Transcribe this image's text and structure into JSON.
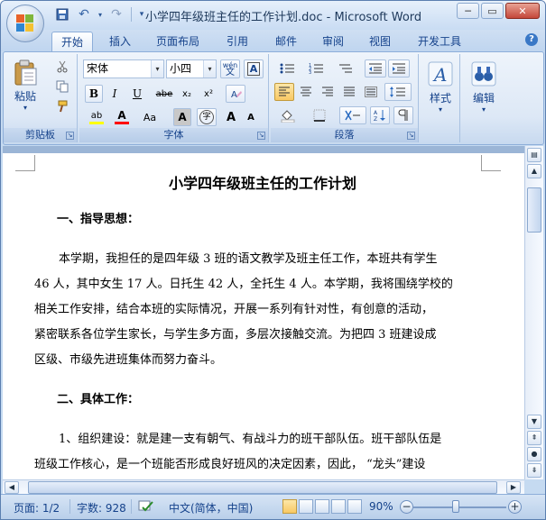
{
  "window": {
    "title": "小学四年级班主任的工作计划.doc - Microsoft Word",
    "controls": {
      "minimize": "─",
      "restore": "▭",
      "close": "✕"
    }
  },
  "qat": {
    "save": "💾",
    "undo": "↶",
    "redo": "↷",
    "customize": "▾"
  },
  "tabs": [
    "开始",
    "插入",
    "页面布局",
    "引用",
    "邮件",
    "审阅",
    "视图",
    "开发工具"
  ],
  "active_tab": "开始",
  "ribbon": {
    "clipboard": {
      "label": "剪贴板",
      "paste": "粘贴",
      "paste_dd": "▾"
    },
    "font": {
      "label": "字体",
      "font_name": "宋体",
      "font_size": "小四",
      "wen": "wén",
      "wen_sub": "文",
      "buttons": {
        "bold": "B",
        "italic": "I",
        "underline": "U",
        "strike": "abe",
        "subscript": "x₂",
        "superscript": "x²",
        "clear": "A",
        "highlight": "ab",
        "fontcolor": "A",
        "changecase": "Aa",
        "charshading": "A",
        "enclose": "字",
        "grow": "A",
        "shrink": "A"
      }
    },
    "paragraph": {
      "label": "段落"
    },
    "styles": {
      "label": "样式"
    },
    "editing": {
      "label": "编辑"
    }
  },
  "document": {
    "title": "小学四年级班主任的工作计划",
    "heading1": "一、指导思想：",
    "para1": [
      "本学期，我担任的是四年级 3 班的语文教学及班主任工作，本班共有学生",
      "46 人，其中女生 17 人。日托生 42 人，全托生 4 人。本学期，我将围绕学校的",
      "相关工作安排，结合本班的实际情况，开展一系列有针对性，有创意的活动，",
      "紧密联系各位学生家长，与学生多方面，多层次接触交流。为把四 3 班建设成",
      "区级、市级先进班集体而努力奋斗。"
    ],
    "heading2": "二、具体工作：",
    "para2": [
      "1、组织建设：就是建一支有朝气、有战斗力的班干部队伍。班干部队伍是",
      "班级工作核心，是一个班能否形成良好班风的决定因素，因此，  “龙头”建设"
    ]
  },
  "status": {
    "page": "页面: 1/2",
    "words": "字数: 928",
    "language": "中文(简体，中国)",
    "zoom": "90%",
    "zoom_minus": "−",
    "zoom_plus": "+"
  }
}
